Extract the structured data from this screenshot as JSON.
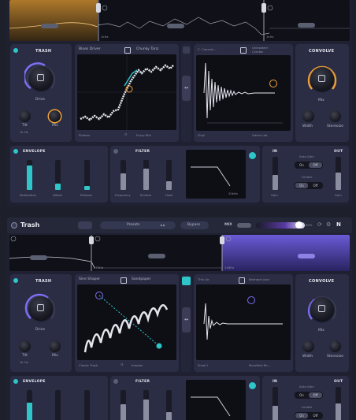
{
  "colors": {
    "bg": "#1d1f2b",
    "panel": "#2a2d44",
    "teal": "#2fc6c9",
    "orange": "#f2a23a",
    "purple": "#7d6ff2"
  },
  "top": {
    "band_freq_1": "1kHz",
    "band_freq_2": "1kHz",
    "trash": {
      "title": "TRASH",
      "knob_drive": "Drive",
      "knob_tilt": "Tilt",
      "knob_tilt_value": "1k Hz",
      "knob_mix": "Mix"
    },
    "distortion": {
      "type_left": "Blues Driver",
      "type_right": "Chunky Tanz",
      "bottom_left": "Plateau",
      "bottom_right": "Fuzzy Bits"
    },
    "convolve_center": {
      "ir_left": "C. Concert...",
      "ir_right_1": "Unlewdeer",
      "ir_right_2": "Cymbis",
      "bottom_left": "Vinyl",
      "bottom_right": "Game Lad"
    },
    "convolve": {
      "title": "CONVOLVE",
      "knob_mix": "Mix",
      "knob_width": "Width",
      "knob_stereoize": "Stereoize"
    },
    "envelope": {
      "title": "ENVELOPE",
      "sliders": [
        "Modulation",
        "Attack",
        "Release"
      ]
    },
    "filter": {
      "title": "FILTER",
      "sliders": [
        "Frequency",
        "Scream",
        "Heat"
      ],
      "cutoff": "20kHz"
    },
    "io": {
      "in": "IN",
      "out": "OUT",
      "gain_in": "Gain",
      "gain_out": "Gain",
      "auto_gain": "Auto Gain",
      "limiter": "Limiter",
      "on": "On",
      "off": "Off"
    }
  },
  "bottom": {
    "app_name": "Trash",
    "presets": "Presets",
    "bypass": "Bypass",
    "mix": "MIX",
    "mix_value": "89%",
    "band_freq_1": "270Hz",
    "band_freq_2": "246Hz",
    "trash": {
      "title": "TRASH",
      "knob_drive": "Drive",
      "knob_tilt": "Tilt",
      "knob_tilt_value": "1k Hz",
      "knob_mix": "Mix"
    },
    "distortion": {
      "type_left": "Sine Shaper",
      "type_right": "Sandpaper",
      "bottom_left": "Classic Trash",
      "bottom_right": "Impaler"
    },
    "convolve_center": {
      "ir_left": "Thin Air",
      "ir_right": "Bedroom Jazz",
      "bottom_left": "Small I",
      "bottom_right": "Morefield Re..."
    },
    "convolve": {
      "title": "CONVOLVE",
      "knob_mix": "Mix",
      "knob_width": "Width",
      "knob_stereoize": "Stereoize"
    },
    "envelope": {
      "title": "ENVELOPE"
    },
    "filter": {
      "title": "FILTER"
    },
    "io": {
      "in": "IN",
      "out": "OUT",
      "auto_gain": "Auto Gain",
      "limiter": "Limiter",
      "on": "On",
      "off": "Off"
    }
  }
}
